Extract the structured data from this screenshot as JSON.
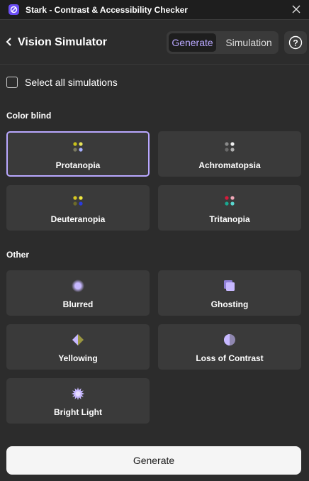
{
  "window": {
    "title": "Stark - Contrast & Accessibility Checker"
  },
  "header": {
    "title": "Vision Simulator",
    "tabs": [
      {
        "label": "Generate",
        "active": true
      },
      {
        "label": "Simulation",
        "active": false
      }
    ],
    "help_label": "?"
  },
  "select_all": {
    "label": "Select all simulations",
    "checked": false
  },
  "sections": {
    "color_blind": {
      "label": "Color blind",
      "items": [
        {
          "label": "Protanopia",
          "icon": "protanopia-dots-icon",
          "selected": true
        },
        {
          "label": "Achromatopsia",
          "icon": "achromatopsia-dots-icon",
          "selected": false
        },
        {
          "label": "Deuteranopia",
          "icon": "deuteranopia-dots-icon",
          "selected": false
        },
        {
          "label": "Tritanopia",
          "icon": "tritanopia-dots-icon",
          "selected": false
        }
      ]
    },
    "other": {
      "label": "Other",
      "items": [
        {
          "label": "Blurred",
          "icon": "blurred-icon"
        },
        {
          "label": "Ghosting",
          "icon": "ghosting-icon"
        },
        {
          "label": "Yellowing",
          "icon": "yellowing-icon"
        },
        {
          "label": "Loss of Contrast",
          "icon": "loss-of-contrast-icon"
        },
        {
          "label": "Bright Light",
          "icon": "bright-light-icon"
        }
      ]
    }
  },
  "footer": {
    "generate_label": "Generate"
  },
  "colors": {
    "accent": "#b9a8ff",
    "brand": "#6c4ef5",
    "background": "#2c2c2c",
    "card": "#3a3a3a"
  }
}
